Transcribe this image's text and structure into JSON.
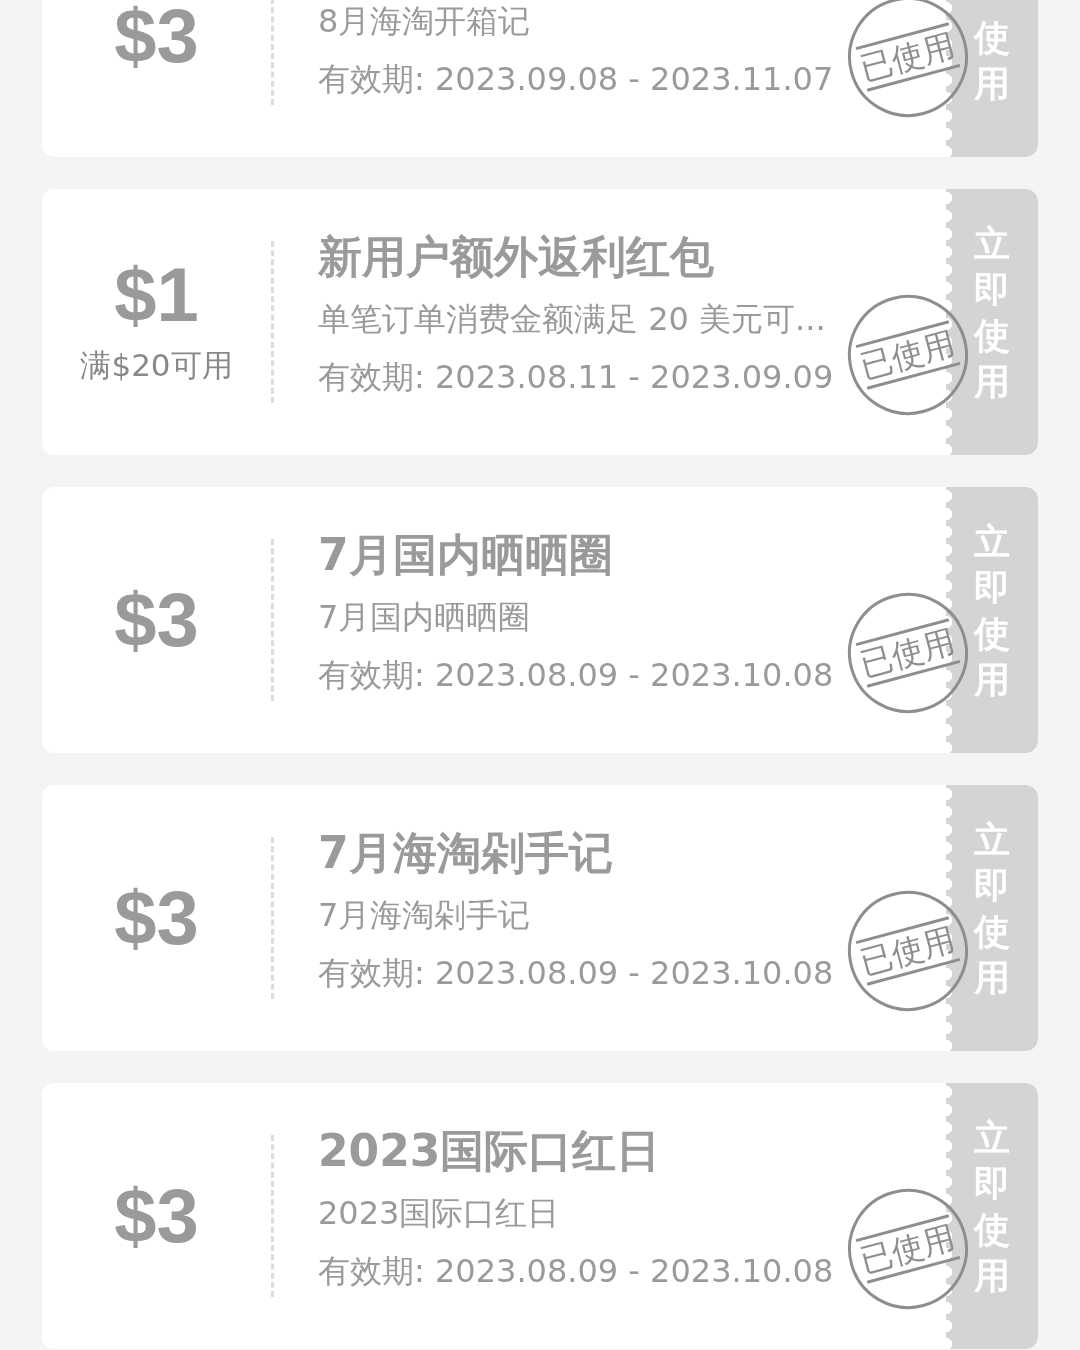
{
  "coupons": [
    {
      "kind": "partial",
      "amount": "$3",
      "subtitle": "8月海淘开箱记",
      "validity": "有效期: 2023.09.08 - 2023.11.07",
      "action": "使用",
      "stamp": "已使用"
    },
    {
      "kind": "full",
      "amount": "$1",
      "condition": "满$20可用",
      "title": "新用户额外返利红包",
      "subtitle": "单笔订单消费金额满足 20 美元可...",
      "validity": "有效期: 2023.08.11 - 2023.09.09",
      "action": "立即使用",
      "stamp": "已使用"
    },
    {
      "kind": "full",
      "amount": "$3",
      "title": "7月国内晒晒圈",
      "subtitle": "7月国内晒晒圈",
      "validity": "有效期: 2023.08.09 - 2023.10.08",
      "action": "立即使用",
      "stamp": "已使用"
    },
    {
      "kind": "full",
      "amount": "$3",
      "title": "7月海淘剁手记",
      "subtitle": "7月海淘剁手记",
      "validity": "有效期: 2023.08.09 - 2023.10.08",
      "action": "立即使用",
      "stamp": "已使用"
    },
    {
      "kind": "full",
      "amount": "$3",
      "title": "2023国际口红日",
      "subtitle": "2023国际口红日",
      "validity": "有效期: 2023.08.09 - 2023.10.08",
      "action": "立即使用",
      "stamp": "已使用"
    }
  ]
}
